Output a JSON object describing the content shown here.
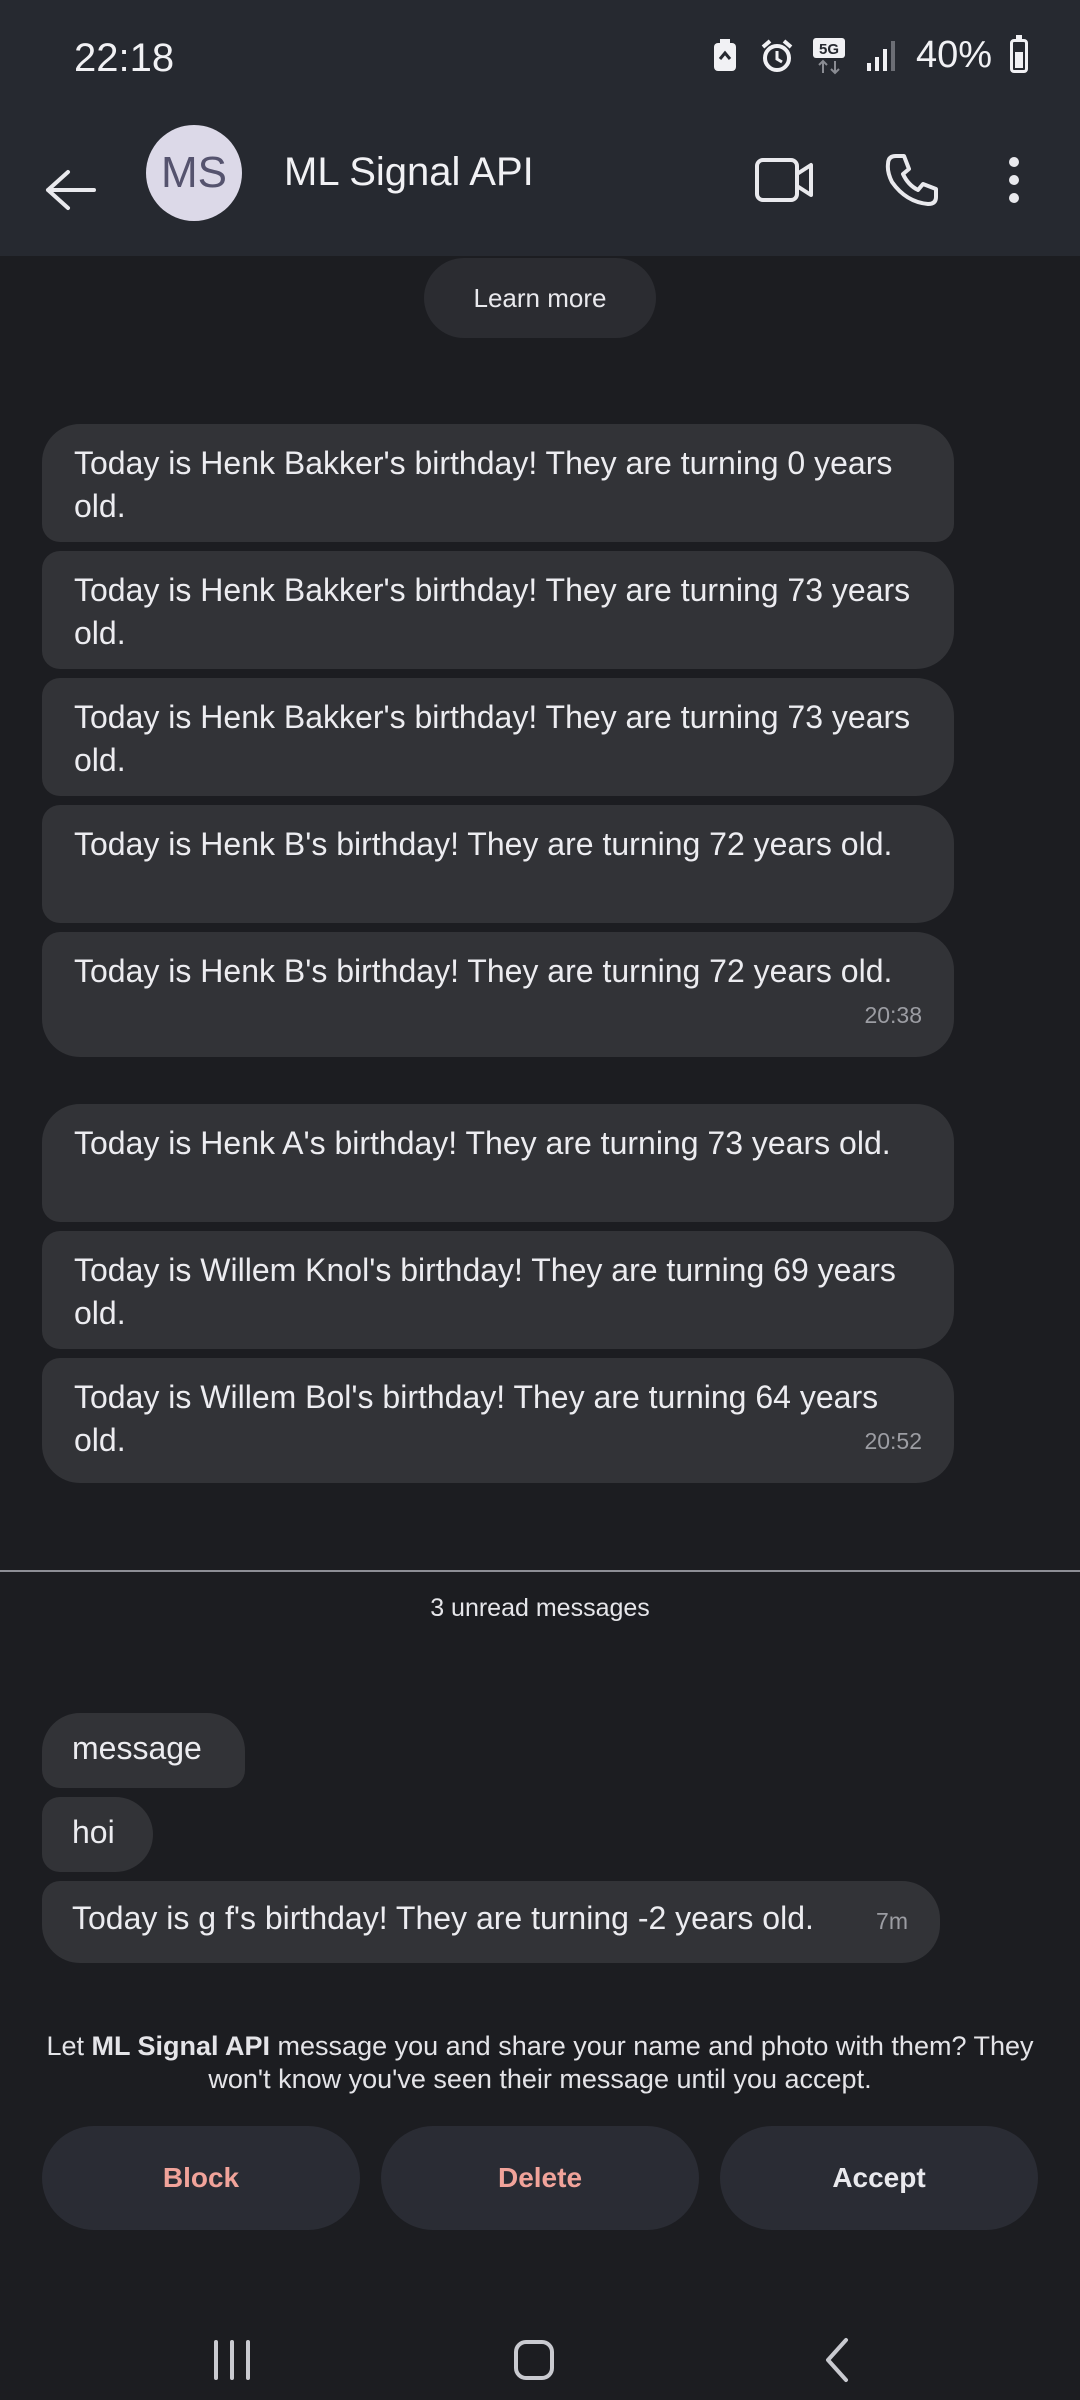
{
  "status_bar": {
    "time": "22:18",
    "battery": "40%",
    "icons": [
      "recycle-icon",
      "alarm-icon",
      "5g-icon",
      "signal-icon",
      "battery-icon"
    ]
  },
  "header": {
    "avatar_initials": "MS",
    "title": "ML Signal API",
    "icons": [
      "back-arrow-icon",
      "video-call-icon",
      "phone-icon",
      "more-vert-icon"
    ]
  },
  "learn_more": "Learn more",
  "messages": [
    {
      "text": "Today is Henk Bakker's birthday! They are turning 0 years old.",
      "time": ""
    },
    {
      "text": "Today is Henk Bakker's birthday! They are turning 73 years old.",
      "time": ""
    },
    {
      "text": "Today is Henk Bakker's birthday! They are turning 73 years old.",
      "time": ""
    },
    {
      "text": "Today is Henk B's birthday! They are turning 72 years old.",
      "time": ""
    },
    {
      "text": "Today is Henk B's birthday! They are turning 72 years old.",
      "time": "20:38"
    },
    {
      "text": "Today is Henk A's birthday! They are turning 73 years old.",
      "time": ""
    },
    {
      "text": "Today is Willem Knol's birthday! They are turning 69 years old.",
      "time": ""
    },
    {
      "text": "Today is Willem Bol's birthday! They are turning 64 years old.",
      "time": "20:52"
    },
    {
      "text": "message",
      "time": ""
    },
    {
      "text": "hoi",
      "time": ""
    },
    {
      "text": "Today is g f's birthday! They are turning -2 years old.",
      "time": "7m"
    }
  ],
  "unread_label": "3 unread messages",
  "request": {
    "prefix": "Let ",
    "name": "ML Signal API",
    "suffix": " message you and share your name and photo with them? They won't know you've seen their message until you accept."
  },
  "actions": {
    "block": "Block",
    "delete": "Delete",
    "accept": "Accept"
  },
  "nav": [
    "recents-icon",
    "home-icon",
    "back-icon"
  ],
  "colors": {
    "background": "#1c1d21",
    "header": "#262930",
    "bubble": "#323337",
    "danger": "#f1a39a"
  }
}
